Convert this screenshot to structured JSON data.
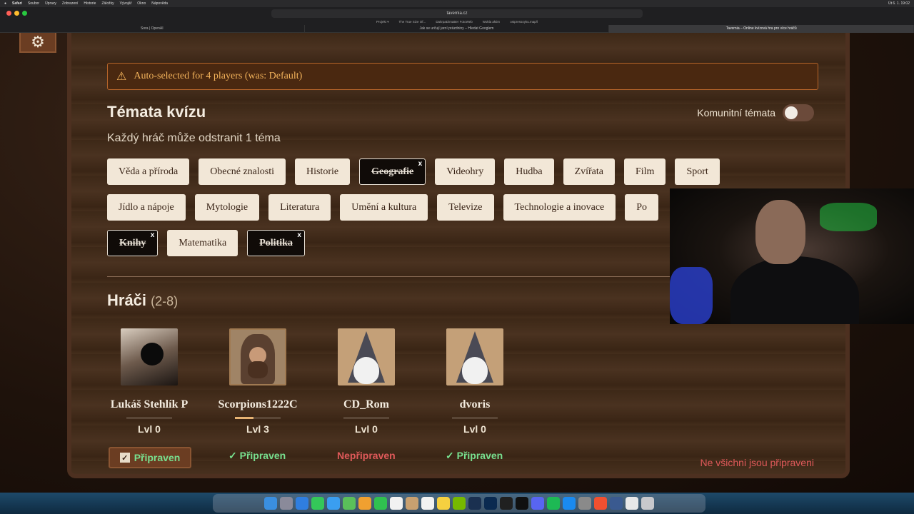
{
  "menubar": {
    "app": "Safari",
    "items": [
      "Soubor",
      "Úpravy",
      "Zobrazení",
      "Historie",
      "Záložky",
      "Vývojář",
      "Okno",
      "Nápověda"
    ],
    "clock": "Út 6. 1. 19:02"
  },
  "browser": {
    "url": "tavernia.cz",
    "favorites": [
      "Projekt ▾",
      "The True Size Of...",
      "DakrpaDimaBer FotoWeb",
      "Wokla aktim",
      "ostpressoyku.map/l"
    ],
    "tabs": [
      {
        "title": "Sora | OpenAI",
        "active": false
      },
      {
        "title": "Jak se určují jarní prázdniny – Hledat Googlem",
        "active": false
      },
      {
        "title": "Tavernia – Online kvízová hra pro více hráčů",
        "active": true
      }
    ]
  },
  "alert": {
    "text": "Auto-selected for 4 players (was: Default)"
  },
  "topics": {
    "title": "Témata kvízu",
    "community_label": "Komunitní témata",
    "community_enabled": false,
    "subtitle": "Každý hráč může odstranit 1 téma",
    "rows": [
      [
        {
          "label": "Věda a příroda",
          "removed": false
        },
        {
          "label": "Obecné znalosti",
          "removed": false
        },
        {
          "label": "Historie",
          "removed": false
        },
        {
          "label": "Geografie",
          "removed": true
        },
        {
          "label": "Videohry",
          "removed": false
        },
        {
          "label": "Hudba",
          "removed": false
        },
        {
          "label": "Zvířata",
          "removed": false
        },
        {
          "label": "Film",
          "removed": false
        },
        {
          "label": "Sport",
          "removed": false
        }
      ],
      [
        {
          "label": "Jídlo a nápoje",
          "removed": false
        },
        {
          "label": "Mytologie",
          "removed": false
        },
        {
          "label": "Literatura",
          "removed": false
        },
        {
          "label": "Umění a kultura",
          "removed": false
        },
        {
          "label": "Televize",
          "removed": false
        },
        {
          "label": "Technologie a inovace",
          "removed": false
        },
        {
          "label": "Po",
          "removed": false
        }
      ],
      [
        {
          "label": "Knihy",
          "removed": true
        },
        {
          "label": "Matematika",
          "removed": false
        },
        {
          "label": "Politika",
          "removed": true
        }
      ]
    ],
    "remove_mark": "x"
  },
  "players": {
    "title": "Hráči",
    "range": "(2-8)",
    "list": [
      {
        "name": "Lukáš Stehlík P",
        "level": "Lvl 0",
        "progress": 0,
        "status": "Připraven",
        "ready": true,
        "is_self": true,
        "avatar": "photo-avatar"
      },
      {
        "name": "Scorpions1222C",
        "level": "Lvl 3",
        "progress": 0.4,
        "status": "Připraven",
        "ready": true,
        "is_self": false,
        "avatar": "hooded-monk-avatar"
      },
      {
        "name": "CD_Rom",
        "level": "Lvl 0",
        "progress": 0,
        "status": "Nepřipraven",
        "ready": false,
        "is_self": false,
        "avatar": "wizard-avatar"
      },
      {
        "name": "dvoris",
        "level": "Lvl 0",
        "progress": 0,
        "status": "Připraven",
        "ready": true,
        "is_self": false,
        "avatar": "wizard-avatar"
      }
    ],
    "not_all_ready": "Ne všichni jsou připraveni"
  },
  "colors": {
    "ready": "#78e08f",
    "not_ready": "#e05a5a",
    "alert_text": "#f3b35b",
    "chip_bg": "#f2e7d7"
  },
  "icons": {
    "settings": "gear-icon",
    "alert": "warning-icon",
    "ready": "check-icon"
  }
}
